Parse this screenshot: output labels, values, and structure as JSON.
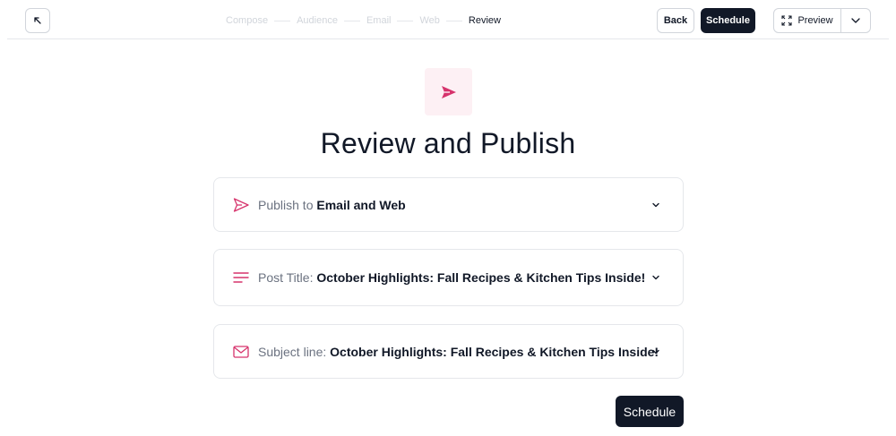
{
  "topbar": {
    "exit_icon": "arrow-up-left-icon",
    "steps": [
      "Compose",
      "Audience",
      "Email",
      "Web",
      "Review"
    ],
    "active_step": "Review",
    "back_label": "Back",
    "schedule_label": "Schedule",
    "preview_label": "Preview",
    "preview_icon": "fullscreen-icon",
    "caret_icon": "chevron-down-icon"
  },
  "main": {
    "hero_icon": "send-icon",
    "title": "Review and Publish",
    "cards": [
      {
        "icon": "send-icon",
        "label": "Publish to",
        "value": "Email and Web"
      },
      {
        "icon": "text-lines-icon",
        "label": "Post Title:",
        "value": "October Highlights: Fall Recipes & Kitchen Tips Inside!"
      },
      {
        "icon": "mail-icon",
        "label": "Subject line:",
        "value": "October Highlights: Fall Recipes & Kitchen Tips Inside!"
      }
    ],
    "schedule_label": "Schedule"
  },
  "colors": {
    "accent": "#d6336c",
    "accent_bg": "#fdf0f4",
    "dark": "#111827",
    "border": "#e5e7eb"
  }
}
